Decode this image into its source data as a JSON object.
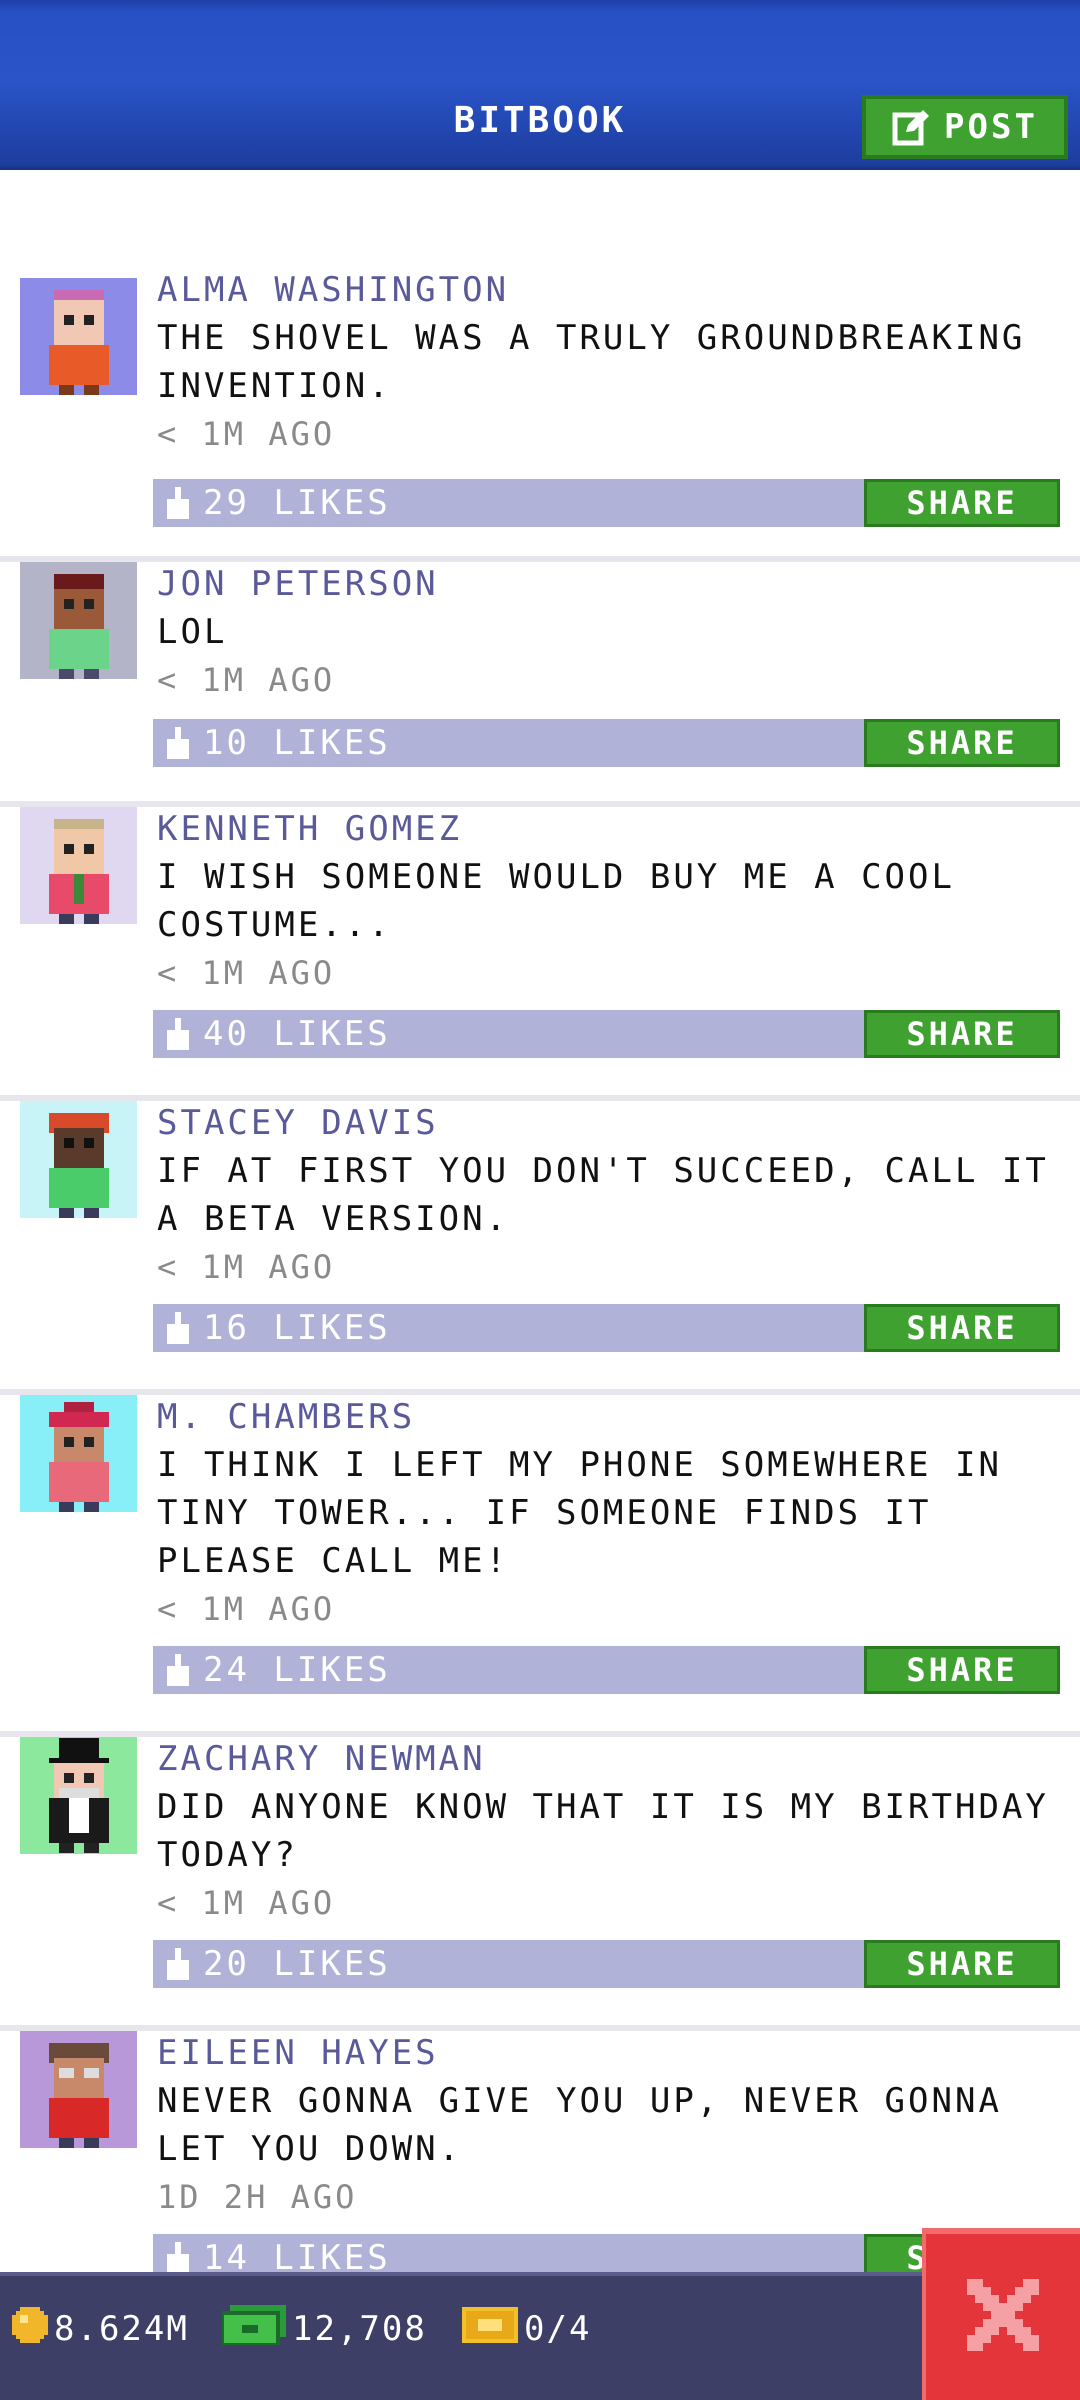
{
  "header": {
    "title": "BITBOOK",
    "post_label": "POST"
  },
  "posts": [
    {
      "author": "ALMA WASHINGTON",
      "message": "THE SHOVEL WAS A TRULY GROUNDBREAKING INVENTION.",
      "time": "< 1M AGO",
      "likes": "29 LIKES",
      "share_label": "SHARE"
    },
    {
      "author": "JON PETERSON",
      "message": "LOL",
      "time": "< 1M AGO",
      "likes": "10 LIKES",
      "share_label": "SHARE"
    },
    {
      "author": "KENNETH GOMEZ",
      "message": "I WISH SOMEONE WOULD BUY ME A COOL COSTUME...",
      "time": "< 1M AGO",
      "likes": "40 LIKES",
      "share_label": "SHARE"
    },
    {
      "author": "STACEY DAVIS",
      "message": "IF AT FIRST YOU DON'T SUCCEED, CALL IT A BETA VERSION.",
      "time": "< 1M AGO",
      "likes": "16 LIKES",
      "share_label": "SHARE"
    },
    {
      "author": "M. CHAMBERS",
      "message": "I THINK I LEFT MY PHONE SOMEWHERE IN TINY TOWER... IF SOMEONE FINDS IT PLEASE CALL ME!",
      "time": "< 1M AGO",
      "likes": "24 LIKES",
      "share_label": "SHARE"
    },
    {
      "author": "ZACHARY NEWMAN",
      "message": "DID ANYONE KNOW THAT IT IS MY BIRTHDAY TODAY?",
      "time": "< 1M AGO",
      "likes": "20 LIKES",
      "share_label": "SHARE"
    },
    {
      "author": "EILEEN HAYES",
      "message": "NEVER GONNA GIVE YOU UP, NEVER GONNA LET YOU DOWN.",
      "time": "1D 2H AGO",
      "likes": "14 LIKES",
      "share_label": "SHARE"
    }
  ],
  "status": {
    "coins": "8.624M",
    "bux": "12,708",
    "tickets": "0/4"
  },
  "colors": {
    "header_blue": "#2a54c8",
    "share_green": "#3fa12f",
    "likes_bar": "#b0b2d8",
    "author_purple": "#5a5a9a",
    "close_red": "#e4353a",
    "bottom_bar": "#3d3f66"
  }
}
